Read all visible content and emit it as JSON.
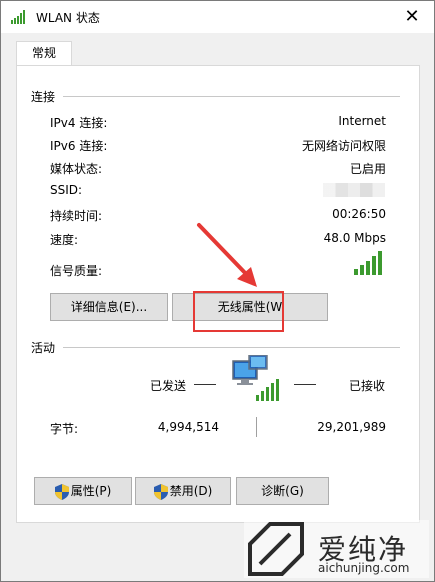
{
  "window": {
    "title": "WLAN 状态",
    "close_glyph": "✕",
    "tab_general": "常规"
  },
  "connection": {
    "section_title": "连接",
    "rows": [
      {
        "label": "IPv4 连接:",
        "value": "Internet"
      },
      {
        "label": "IPv6 连接:",
        "value": "无网络访问权限"
      },
      {
        "label": "媒体状态:",
        "value": "已启用"
      },
      {
        "label": "SSID:",
        "value": ""
      },
      {
        "label": "持续时间:",
        "value": "00:26:50"
      },
      {
        "label": "速度:",
        "value": "48.0 Mbps"
      }
    ],
    "signal_label": "信号质量:",
    "signal_bars_active": 5,
    "signal_bars_total": 5,
    "details_button": "详细信息(E)...",
    "wireless_properties_button": "无线属性(W"
  },
  "activity": {
    "section_title": "活动",
    "sent_label": "已发送",
    "received_label": "已接收",
    "bytes_label": "字节:",
    "bytes_sent": "4,994,514",
    "bytes_received": "29,201,989"
  },
  "footer": {
    "properties_button": "属性(P)",
    "disable_button": "禁用(D)",
    "diagnose_button": "诊断(G)"
  },
  "watermark": {
    "name": "爱纯净",
    "url": "aichunjing.com"
  },
  "colors": {
    "signal_green": "#3c9a2f",
    "annotation_red": "#e53935",
    "shield_blue": "#2a5db0",
    "shield_yellow": "#f0c330"
  },
  "icons": [
    "wifi-signal-icon",
    "close-icon",
    "network-computers-icon",
    "shield-icon",
    "annotation-arrow-icon",
    "watermark-logo-icon"
  ]
}
